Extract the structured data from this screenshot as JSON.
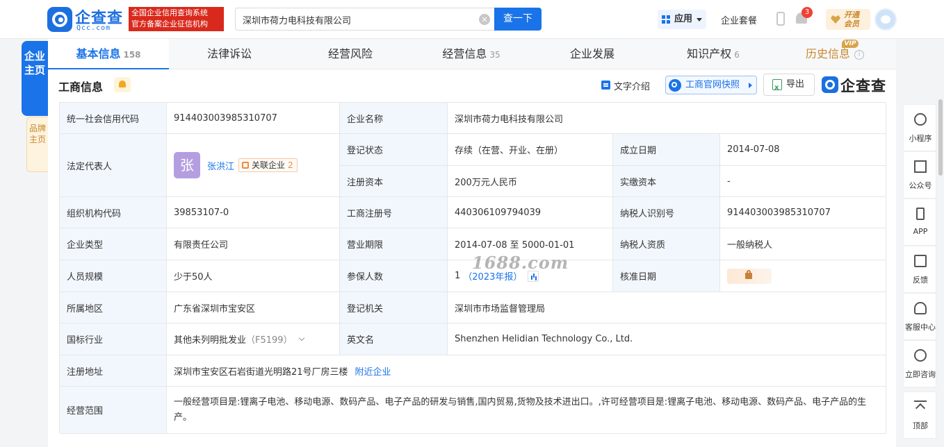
{
  "header": {
    "logo_text": "企查查",
    "logo_sub": "Qcc.com",
    "slogan_line1": "全国企业信用查询系统",
    "slogan_line2": "官方备案企业征信机构",
    "search_value": "深圳市荷力电科技有限公司",
    "search_button": "查一下",
    "app_label": "应用",
    "package_label": "企业套餐",
    "notification_count": "3",
    "vip_line1": "开通",
    "vip_line2": "会员"
  },
  "left_tabs": {
    "main": "企业主页",
    "brand": "品牌主页"
  },
  "tabs": [
    {
      "label": "基本信息",
      "count": "158"
    },
    {
      "label": "法律诉讼",
      "count": ""
    },
    {
      "label": "经营风险",
      "count": ""
    },
    {
      "label": "经营信息",
      "count": "35"
    },
    {
      "label": "企业发展",
      "count": ""
    },
    {
      "label": "知识产权",
      "count": "6"
    },
    {
      "label": "历史信息",
      "count": "",
      "badge": "VIP"
    }
  ],
  "section": {
    "title": "工商信息",
    "text_intro": "文字介绍",
    "snapshot": "工商官网快照",
    "export": "导出",
    "brand": "企查查"
  },
  "info": {
    "credit_code_label": "统一社会信用代码",
    "credit_code": "914403003985310707",
    "company_name_label": "企业名称",
    "company_name": "深圳市荷力电科技有限公司",
    "legal_rep_label": "法定代表人",
    "legal_rep_avatar": "张",
    "legal_rep_name": "张洪江",
    "related_label": "关联企业",
    "related_count": "2",
    "reg_status_label": "登记状态",
    "reg_status": "存续（在营、开业、在册）",
    "found_date_label": "成立日期",
    "found_date": "2014-07-08",
    "reg_capital_label": "注册资本",
    "reg_capital": "200万元人民币",
    "paid_capital_label": "实缴资本",
    "paid_capital": "-",
    "org_code_label": "组织机构代码",
    "org_code": "39853107-0",
    "biz_reg_no_label": "工商注册号",
    "biz_reg_no": "440306109794039",
    "taxpayer_id_label": "纳税人识别号",
    "taxpayer_id": "914403003985310707",
    "company_type_label": "企业类型",
    "company_type": "有限责任公司",
    "biz_term_label": "营业期限",
    "biz_term": "2014-07-08 至 5000-01-01",
    "taxpayer_qual_label": "纳税人资质",
    "taxpayer_qual": "一般纳税人",
    "staff_size_label": "人员规模",
    "staff_size": "少于50人",
    "insured_label": "参保人数",
    "insured_count": "1",
    "insured_year": "（2023年报）",
    "approval_date_label": "核准日期",
    "region_label": "所属地区",
    "region": "广东省深圳市宝安区",
    "reg_authority_label": "登记机关",
    "reg_authority": "深圳市市场监督管理局",
    "industry_label": "国标行业",
    "industry": "其他未列明批发业",
    "industry_code": "（F5199）",
    "english_name_label": "英文名",
    "english_name": "Shenzhen Helidian Technology Co., Ltd.",
    "address_label": "注册地址",
    "address": "深圳市宝安区石岩街道光明路21号厂房三楼",
    "nearby_label": "附近企业",
    "scope_label": "经营范围",
    "scope": "一般经营项目是:锂离子电池、移动电源、数码产品、电子产品的研发与销售,国内贸易,货物及技术进出口。,许可经营项目是:锂离子电池、移动电源、数码产品、电子产品的生产。"
  },
  "watermark": "1688.com",
  "side_tools": [
    {
      "label": "小程序",
      "icon": "mini-program-icon"
    },
    {
      "label": "公众号",
      "icon": "official-account-icon"
    },
    {
      "label": "APP",
      "icon": "phone-icon"
    },
    {
      "label": "反馈",
      "icon": "feedback-icon"
    },
    {
      "label": "客服中心",
      "icon": "headset-icon"
    },
    {
      "label": "立即咨询",
      "icon": "chat-icon"
    },
    {
      "label": "顶部",
      "icon": "back-to-top-icon"
    }
  ],
  "colors": {
    "primary": "#1a73e8",
    "slogan_bg": "#d9291c",
    "vip_gold": "#c9892e",
    "label_bg": "#f2f7fd"
  }
}
